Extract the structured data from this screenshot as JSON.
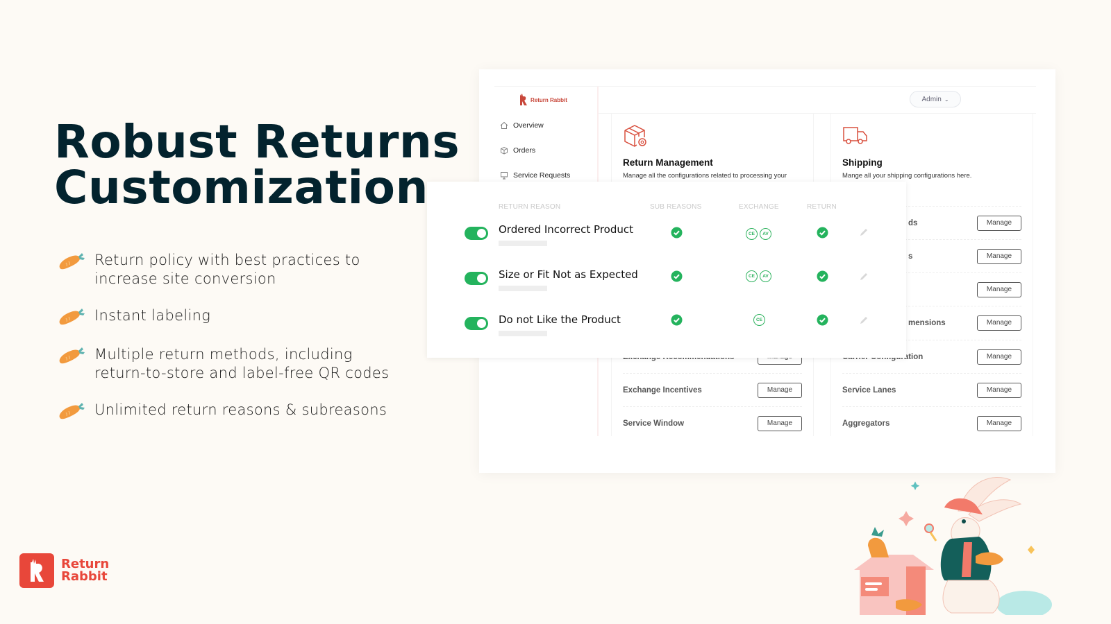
{
  "hero": {
    "title_line1": "Robust Returns",
    "title_line2": "Customization",
    "title_color": "#03232e"
  },
  "bullets": [
    {
      "icon": "carrot-icon",
      "line1": "Return policy with best practices to",
      "line2": "increase site conversion"
    },
    {
      "icon": "carrot-icon",
      "line1": "Instant labeling",
      "line2": ""
    },
    {
      "icon": "carrot-icon",
      "line1": "Multiple return methods, including",
      "line2": "return-to-store and label-free QR codes"
    },
    {
      "icon": "carrot-icon",
      "line1": "Unlimited return reasons & subreasons",
      "line2": ""
    }
  ],
  "brand": {
    "line1": "Return",
    "line2": "Rabbit",
    "color": "#e8473a"
  },
  "app": {
    "brand_name": "Return Rabbit",
    "nav": [
      {
        "label": "Overview",
        "icon": "home-icon"
      },
      {
        "label": "Orders",
        "icon": "box-icon"
      },
      {
        "label": "Service Requests",
        "icon": "monitor-icon"
      }
    ],
    "admin_label": "Admin",
    "return_management": {
      "title": "Return Management",
      "description": "Manage all the configurations related to processing your",
      "rows": [
        {
          "label": "Exchange Recommendations",
          "button": "Manage"
        },
        {
          "label": "Exchange Incentives",
          "button": "Manage"
        },
        {
          "label": "Service Window",
          "button": "Manage"
        }
      ]
    },
    "shipping": {
      "title": "Shipping",
      "description": "Mange all your shipping configurations here.",
      "rows": [
        {
          "label": "ds",
          "button": "Manage"
        },
        {
          "label": "s",
          "button": "Manage"
        },
        {
          "label": "",
          "button": "Manage"
        },
        {
          "label": "mensions",
          "button": "Manage"
        },
        {
          "label": "Carrier Configuration",
          "button": "Manage"
        },
        {
          "label": "Service Lanes",
          "button": "Manage"
        },
        {
          "label": "Aggregators",
          "button": "Manage"
        }
      ]
    }
  },
  "reasons_table": {
    "headers": {
      "reason": "RETURN REASON",
      "sub": "SUB REASONS",
      "exchange": "EXCHANGE",
      "return": "RETURN"
    },
    "rows": [
      {
        "label": "Ordered Incorrect Product",
        "enabled": true,
        "sub_reasons": true,
        "exchange": [
          "CE",
          "AV"
        ],
        "return": true
      },
      {
        "label": "Size or Fit Not as Expected",
        "enabled": true,
        "sub_reasons": true,
        "exchange": [
          "CE",
          "AV"
        ],
        "return": true
      },
      {
        "label": "Do not Like the Product",
        "enabled": true,
        "sub_reasons": true,
        "exchange": [
          "CE"
        ],
        "return": true
      }
    ],
    "accent": "#24b35d"
  }
}
